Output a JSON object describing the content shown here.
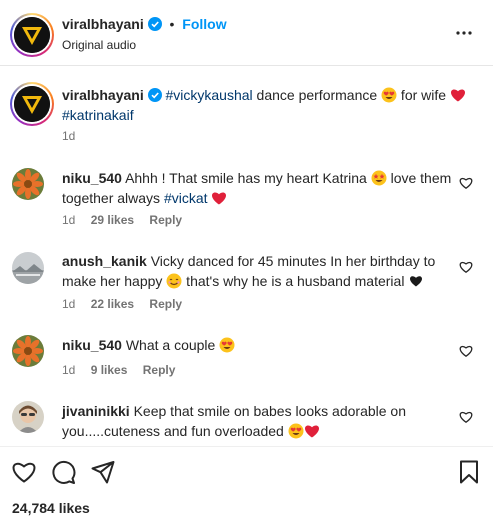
{
  "header": {
    "username": "viralbhayani",
    "separator": "•",
    "follow_label": "Follow",
    "audio": "Original audio"
  },
  "caption": {
    "username": "viralbhayani",
    "tag1": "#vickykaushal",
    "text1": " dance performance ",
    "text2": " for wife ",
    "tag2": "#katrinakaif",
    "time": "1d"
  },
  "comments": [
    {
      "username": "niku_540",
      "text1": "Ahhh ! That smile has my heart Katrina ",
      "text2": " love them together always ",
      "tag": "#vickat",
      "time": "1d",
      "likes": "29 likes",
      "reply": "Reply"
    },
    {
      "username": "anush_kanik",
      "text1": "Vicky danced for 45 minutes In her birthday to make her happy ",
      "text2": " that's why he is a husband material ",
      "time": "1d",
      "likes": "22 likes",
      "reply": "Reply"
    },
    {
      "username": "niku_540",
      "text1": "What a couple ",
      "time": "1d",
      "likes": "9 likes",
      "reply": "Reply"
    },
    {
      "username": "jivaninikki",
      "text1": "Keep that smile on babes looks adorable on you.....cuteness and fun overloaded "
    }
  ],
  "likes_total": "24,784 likes",
  "colors": {
    "accent": "#0095f6",
    "tag": "#00376b",
    "heart": "#ed4956",
    "muted": "#737373"
  }
}
